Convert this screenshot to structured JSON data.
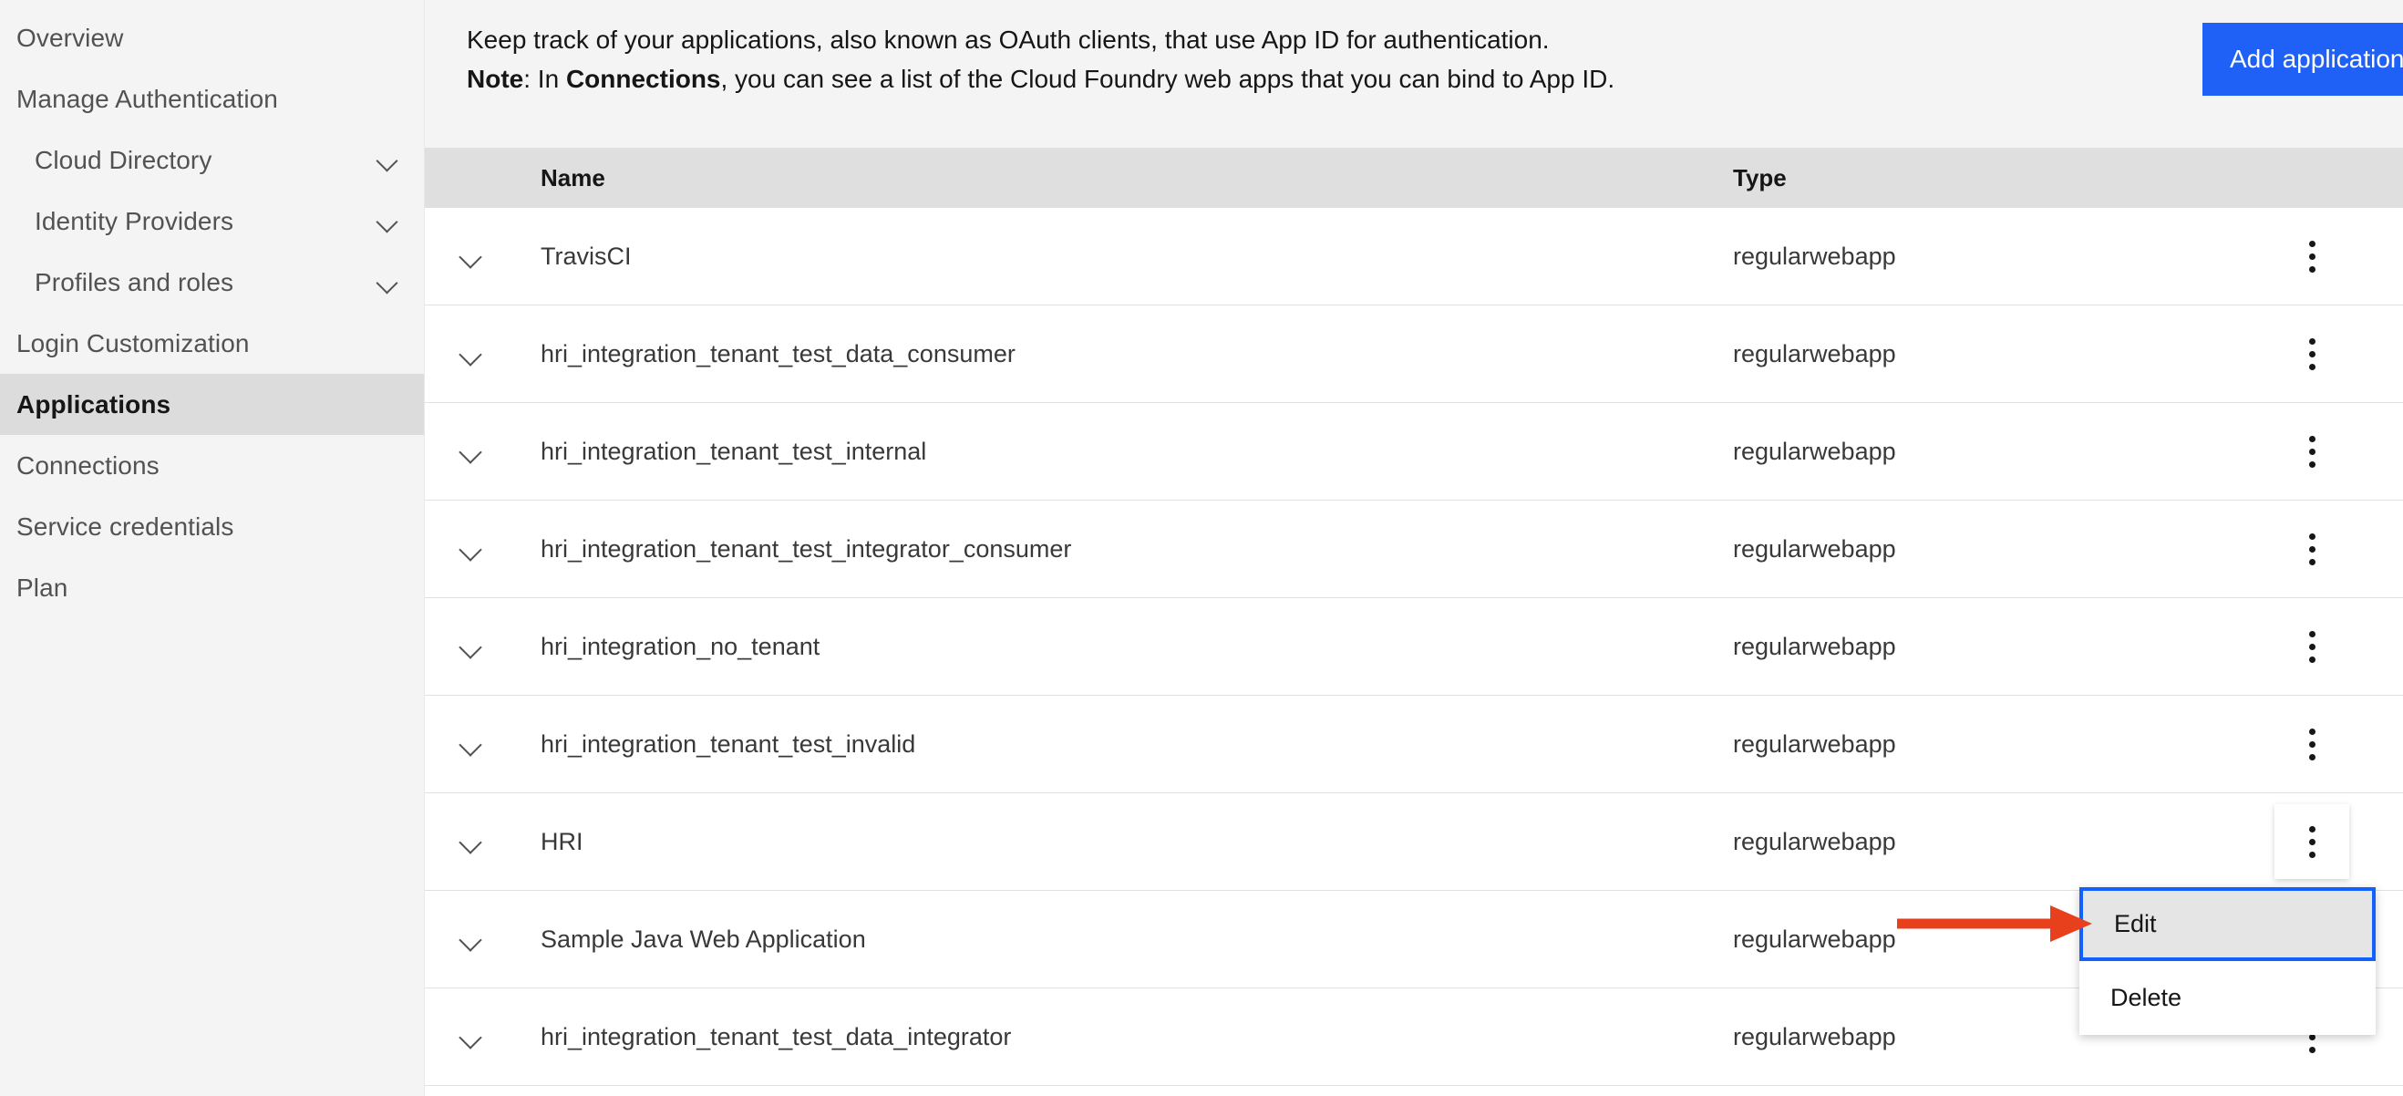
{
  "sidebar": {
    "items": [
      {
        "label": "Overview",
        "sub": false,
        "chevron": false,
        "active": false
      },
      {
        "label": "Manage Authentication",
        "sub": false,
        "chevron": false,
        "active": false
      },
      {
        "label": "Cloud Directory",
        "sub": true,
        "chevron": true,
        "active": false
      },
      {
        "label": "Identity Providers",
        "sub": true,
        "chevron": true,
        "active": false
      },
      {
        "label": "Profiles and roles",
        "sub": true,
        "chevron": true,
        "active": false
      },
      {
        "label": "Login Customization",
        "sub": false,
        "chevron": false,
        "active": false
      },
      {
        "label": "Applications",
        "sub": false,
        "chevron": false,
        "active": true
      },
      {
        "label": "Connections",
        "sub": false,
        "chevron": false,
        "active": false
      },
      {
        "label": "Service credentials",
        "sub": false,
        "chevron": false,
        "active": false
      },
      {
        "label": "Plan",
        "sub": false,
        "chevron": false,
        "active": false
      }
    ]
  },
  "header": {
    "line1": "Keep track of your applications, also known as OAuth clients, that use App ID for authentication.",
    "note_label": "Note",
    "note_rest_a": ": In ",
    "note_bold": "Connections",
    "note_rest_b": ", you can see a list of the Cloud Foundry web apps that you can bind to App ID.",
    "add_application_label": "Add application",
    "accent_color": "#1f60f7"
  },
  "table": {
    "columns": {
      "name": "Name",
      "type": "Type"
    },
    "rows": [
      {
        "name": "TravisCI",
        "type": "regularwebapp"
      },
      {
        "name": "hri_integration_tenant_test_data_consumer",
        "type": "regularwebapp"
      },
      {
        "name": "hri_integration_tenant_test_internal",
        "type": "regularwebapp"
      },
      {
        "name": "hri_integration_tenant_test_integrator_consumer",
        "type": "regularwebapp"
      },
      {
        "name": "hri_integration_no_tenant",
        "type": "regularwebapp"
      },
      {
        "name": "hri_integration_tenant_test_invalid",
        "type": "regularwebapp"
      },
      {
        "name": "HRI",
        "type": "regularwebapp"
      },
      {
        "name": "Sample Java Web Application",
        "type": "regularwebapp"
      },
      {
        "name": "hri_integration_tenant_test_data_integrator",
        "type": "regularwebapp"
      }
    ]
  },
  "overflow_menu": {
    "open_on_row": "HRI",
    "items": [
      {
        "label": "Edit",
        "focused": true
      },
      {
        "label": "Delete",
        "focused": false
      }
    ],
    "focus_color": "#0f62fe"
  },
  "annotation": {
    "arrow_color": "#e8401c",
    "points_to": "Edit"
  }
}
